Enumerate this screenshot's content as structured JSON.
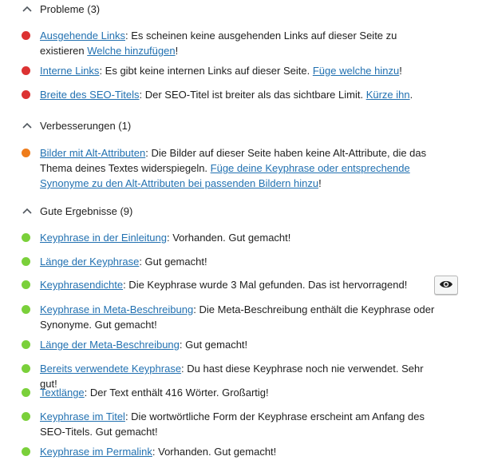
{
  "sections": {
    "problems": {
      "title": "Probleme (3)"
    },
    "improvements": {
      "title": "Verbesserungen (1)"
    },
    "good": {
      "title": "Gute Ergebnisse (9)"
    }
  },
  "colors": {
    "problem": "#dc3232",
    "improvement": "#ee7c1b",
    "good": "#7ad03a",
    "link": "#2271b1"
  },
  "problems": [
    {
      "link": "Ausgehende Links",
      "text": ": Es scheinen keine ausgehenden Links auf dieser Seite zu existieren ",
      "action": "Welche hinzufügen",
      "suffix": "!"
    },
    {
      "link": "Interne Links",
      "text": ": Es gibt keine internen Links auf dieser Seite. ",
      "action": "Füge welche hinzu",
      "suffix": "!"
    },
    {
      "link": "Breite des SEO-Titels",
      "text": ": Der SEO-Titel ist breiter als das sichtbare Limit. ",
      "action": "Kürze ihn",
      "suffix": "."
    }
  ],
  "improvements": [
    {
      "link": "Bilder mit Alt-Attributen",
      "text": ": Die Bilder auf dieser Seite haben keine Alt-Attribute, die das Thema deines Textes widerspiegeln. ",
      "action": "Füge deine Keyphrase oder entsprechende Synonyme zu den Alt-Attributen bei passenden Bildern hinzu",
      "suffix": "!"
    }
  ],
  "good": [
    {
      "link": "Keyphrase in der Einleitung",
      "text": ": Vorhanden. Gut gemacht!"
    },
    {
      "link": "Länge der Keyphrase",
      "text": ": Gut gemacht!"
    },
    {
      "link": "Keyphrasendichte",
      "text": ": Die Keyphrase wurde 3 Mal gefunden. Das ist hervorragend!"
    },
    {
      "link": "Keyphrase in Meta-Beschreibung",
      "text": ": Die Meta-Beschreibung enthält die Keyphrase oder Synonyme. Gut gemacht!"
    },
    {
      "link": "Länge der Meta-Beschreibung",
      "text": ": Gut gemacht!"
    },
    {
      "link": "Bereits verwendete Keyphrase",
      "text": ": Du hast diese Keyphrase noch nie verwendet. Sehr gut!"
    },
    {
      "link": "Textlänge",
      "text": ": Der Text enthält 416 Wörter. Großartig!"
    },
    {
      "link": "Keyphrase im Titel",
      "text": ": Die wortwörtliche Form der Keyphrase erscheint am Anfang des SEO-Titels. Gut gemacht!"
    },
    {
      "link": "Keyphrase im Permalink",
      "text": ": Vorhanden. Gut gemacht!"
    }
  ],
  "eye_button": {
    "icon": "eye-icon"
  }
}
